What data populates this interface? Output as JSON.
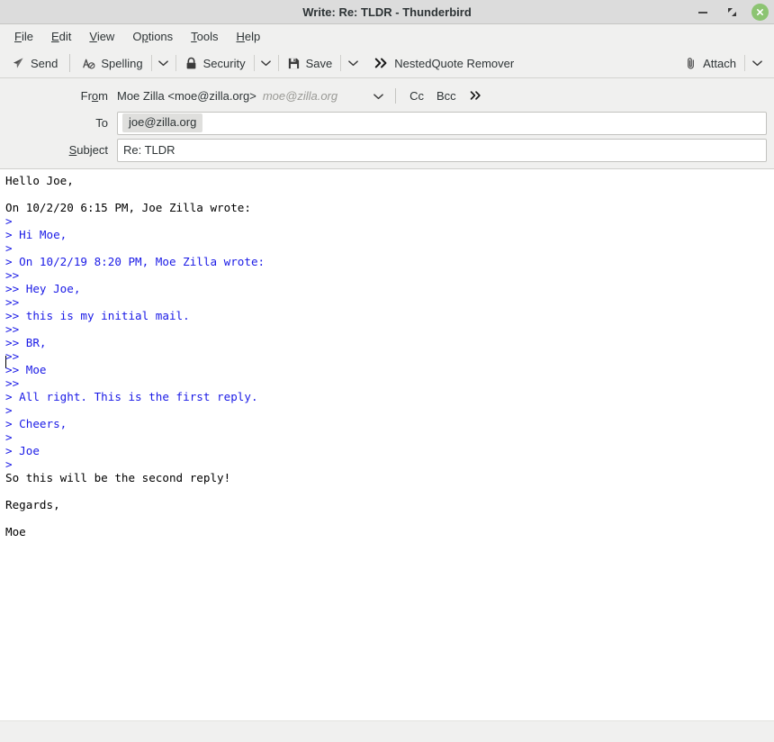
{
  "window": {
    "title": "Write: Re: TLDR - Thunderbird",
    "minimize_label": "Minimize",
    "restore_label": "Restore",
    "close_label": "Close"
  },
  "menubar": {
    "items": [
      {
        "label": "File",
        "accesskey_index": 0
      },
      {
        "label": "Edit",
        "accesskey_index": 0
      },
      {
        "label": "View",
        "accesskey_index": 0
      },
      {
        "label": "Options",
        "accesskey_index": 1
      },
      {
        "label": "Tools",
        "accesskey_index": 0
      },
      {
        "label": "Help",
        "accesskey_index": 0
      }
    ]
  },
  "toolbar": {
    "send_label": "Send",
    "send_icon": "send-paperplane-icon",
    "spelling_label": "Spelling",
    "spelling_icon": "spellcheck-abc-icon",
    "spelling_dropdown_icon": "chevron-down-icon",
    "security_label": "Security",
    "security_icon": "padlock-icon",
    "security_dropdown_icon": "chevron-down-icon",
    "save_label": "Save",
    "save_icon": "floppy-disk-icon",
    "save_dropdown_icon": "chevron-down-icon",
    "nestedquote_label": "NestedQuote Remover",
    "nestedquote_icon": "double-chevron-right-icon",
    "attach_label": "Attach",
    "attach_icon": "paperclip-icon",
    "attach_dropdown_icon": "chevron-down-icon"
  },
  "headers": {
    "from": {
      "label": "From",
      "accesskey_index": 2,
      "value": "Moe Zilla <moe@zilla.org>",
      "domain_hint": "moe@zilla.org",
      "dropdown_icon": "chevron-down-icon",
      "cc_label": "Cc",
      "bcc_label": "Bcc",
      "more_label": "»",
      "more_icon": "double-chevron-right-icon"
    },
    "to": {
      "label": "To",
      "recipients": [
        "joe@zilla.org"
      ],
      "placeholder": ""
    },
    "subject": {
      "label": "Subject",
      "accesskey_index": 0,
      "value": "Re: TLDR",
      "placeholder": ""
    }
  },
  "compose": {
    "lines": [
      {
        "text": "Hello Joe,",
        "quoted": false
      },
      {
        "text": "",
        "quoted": false
      },
      {
        "text": "On 10/2/20 6:15 PM, Joe Zilla wrote:",
        "quoted": false
      },
      {
        "text": ">",
        "quoted": true
      },
      {
        "text": "> Hi Moe,",
        "quoted": true
      },
      {
        "text": ">",
        "quoted": true
      },
      {
        "text": "> On 10/2/19 8:20 PM, Moe Zilla wrote:",
        "quoted": true
      },
      {
        "text": ">>",
        "quoted": true
      },
      {
        "text": ">> Hey Joe,",
        "quoted": true
      },
      {
        "text": ">>",
        "quoted": true
      },
      {
        "text": ">> this is my initial mail.",
        "quoted": true
      },
      {
        "text": ">>",
        "quoted": true
      },
      {
        "text": ">> BR,",
        "quoted": true
      },
      {
        "text": ">>",
        "quoted": true
      },
      {
        "text": ">> Moe",
        "quoted": true
      },
      {
        "text": ">>",
        "quoted": true
      },
      {
        "text": "> All right. This is the first reply.",
        "quoted": true
      },
      {
        "text": ">",
        "quoted": true
      },
      {
        "text": "> Cheers,",
        "quoted": true
      },
      {
        "text": ">",
        "quoted": true
      },
      {
        "text": "> Joe",
        "quoted": true
      },
      {
        "text": ">",
        "quoted": true
      },
      {
        "text": "So this will be the second reply!",
        "quoted": false
      },
      {
        "text": "",
        "quoted": false
      },
      {
        "text": "Regards,",
        "quoted": false
      },
      {
        "text": "",
        "quoted": false
      },
      {
        "text": "Moe",
        "quoted": false
      }
    ]
  },
  "statusbar": {
    "text": ""
  },
  "colors": {
    "chrome": "#f0f0ef",
    "titlebar": "#dcdcdc",
    "quote_blue": "#1a1ae6",
    "close_green": "#8cc472",
    "pill_gray": "#dfdfdd"
  }
}
